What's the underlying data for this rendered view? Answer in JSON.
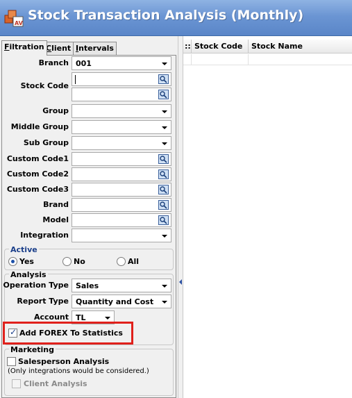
{
  "window": {
    "title": "Stock Transaction Analysis (Monthly)"
  },
  "tabs": [
    {
      "label": "Filtration",
      "underline": "F",
      "rest": "iltration"
    },
    {
      "label": "Client",
      "underline": "C",
      "rest": "lient"
    },
    {
      "label": "Intervals",
      "underline": "I",
      "rest": "ntervals"
    }
  ],
  "filters": {
    "branch": {
      "label": "Branch",
      "value": "001"
    },
    "stock_code": {
      "label": "Stock Code",
      "value_from": "",
      "value_to": ""
    },
    "group": {
      "label": "Group",
      "value": ""
    },
    "middle_group": {
      "label": "Middle Group",
      "value": ""
    },
    "sub_group": {
      "label": "Sub Group",
      "value": ""
    },
    "custom_code1": {
      "label": "Custom Code1",
      "value": ""
    },
    "custom_code2": {
      "label": "Custom Code2",
      "value": ""
    },
    "custom_code3": {
      "label": "Custom Code3",
      "value": ""
    },
    "brand": {
      "label": "Brand",
      "value": ""
    },
    "model": {
      "label": "Model",
      "value": ""
    },
    "integration": {
      "label": "Integration",
      "value": ""
    }
  },
  "active": {
    "title": "Active",
    "options": [
      "Yes",
      "No",
      "All"
    ],
    "selected": "Yes"
  },
  "analysis": {
    "title": "Analysis",
    "operation_type": {
      "label": "Operation Type",
      "value": "Sales"
    },
    "report_type": {
      "label": "Report Type",
      "value": "Quantity and Cost"
    },
    "account": {
      "label": "Account",
      "value": "TL"
    },
    "add_forex": {
      "label": "Add FOREX To Statistics",
      "checked": true
    }
  },
  "marketing": {
    "title": "Marketing",
    "salesperson": {
      "label": "Salesperson Analysis",
      "checked": false
    },
    "note": "(Only integrations would be considered.)",
    "client_analysis": {
      "label": "Client Analysis",
      "checked": false,
      "disabled": true
    }
  },
  "grid": {
    "columns": [
      "Stock Code",
      "Stock Name"
    ],
    "indicator": "::"
  },
  "colors": {
    "titlebar": "#6b95d3",
    "highlight_border": "#e0201b",
    "active_title": "#1b3f8a"
  }
}
